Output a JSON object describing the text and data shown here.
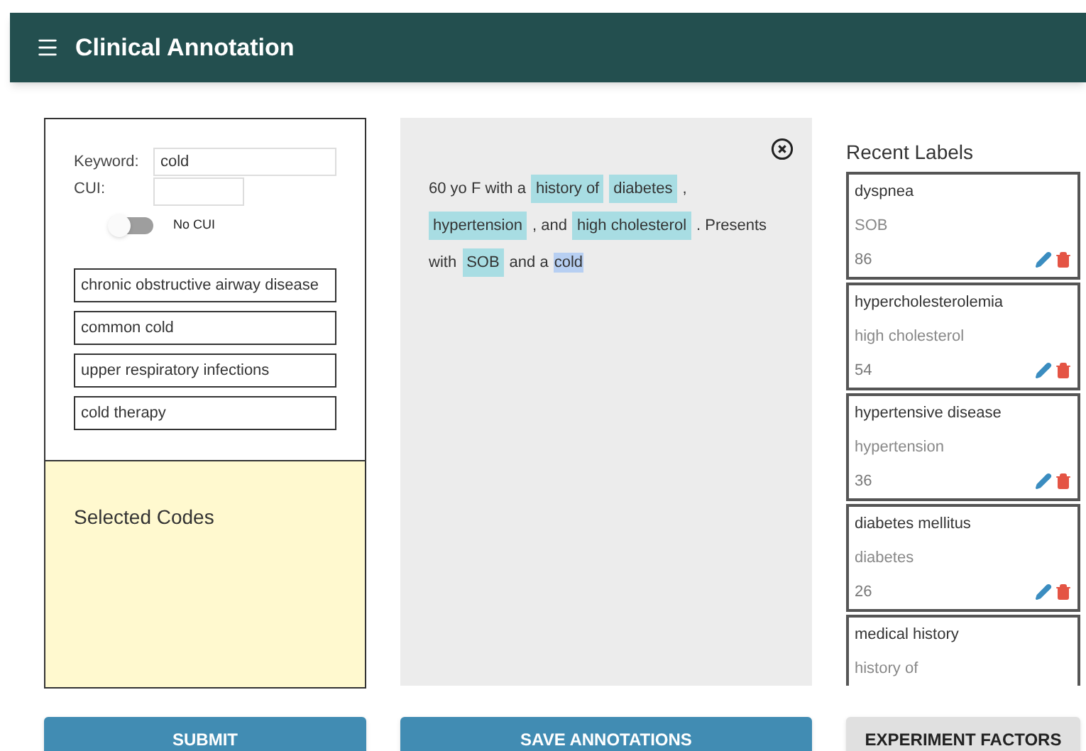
{
  "app_bar": {
    "title": "Clinical Annotation"
  },
  "search": {
    "keyword_label": "Keyword:",
    "keyword_value": "cold",
    "cui_label": "CUI:",
    "no_cui": {
      "label": "No CUI",
      "on": false
    },
    "results": [
      {
        "label": "chronic obstructive airway disease"
      },
      {
        "label": "common cold"
      },
      {
        "label": "upper respiratory infections"
      },
      {
        "label": "cold therapy"
      }
    ]
  },
  "selected_codes": {
    "title": "Selected Codes"
  },
  "document": {
    "segments": [
      {
        "text": "60 yo F with a",
        "kind": "plain"
      },
      {
        "text": "history of",
        "kind": "highlight"
      },
      {
        "text": "diabetes",
        "kind": "highlight"
      },
      {
        "text": ",",
        "kind": "plain"
      },
      {
        "text": "hypertension",
        "kind": "highlight"
      },
      {
        "text": ", and",
        "kind": "plain"
      },
      {
        "text": "high cholesterol",
        "kind": "highlight"
      },
      {
        "text": ". Presents",
        "kind": "plain"
      },
      {
        "text": "with",
        "kind": "plain"
      },
      {
        "text": "SOB",
        "kind": "highlight"
      },
      {
        "text": "and a",
        "kind": "plain"
      },
      {
        "text": "cold",
        "kind": "selected"
      }
    ]
  },
  "recent_labels": {
    "title": "Recent Labels",
    "items": [
      {
        "name": "dyspnea",
        "text": "SOB",
        "count": "86"
      },
      {
        "name": "hypercholesterolemia",
        "text": "high cholesterol",
        "count": "54"
      },
      {
        "name": "hypertensive disease",
        "text": "hypertension",
        "count": "36"
      },
      {
        "name": "diabetes mellitus",
        "text": "diabetes",
        "count": "26"
      },
      {
        "name": "medical history",
        "text": "history of"
      }
    ]
  },
  "buttons": [
    {
      "label": "SUBMIT",
      "kind": "primary"
    },
    {
      "label": "SAVE ANNOTATIONS",
      "kind": "primary"
    },
    {
      "label": "EXPERIMENT FACTORS",
      "kind": "secondary"
    }
  ]
}
